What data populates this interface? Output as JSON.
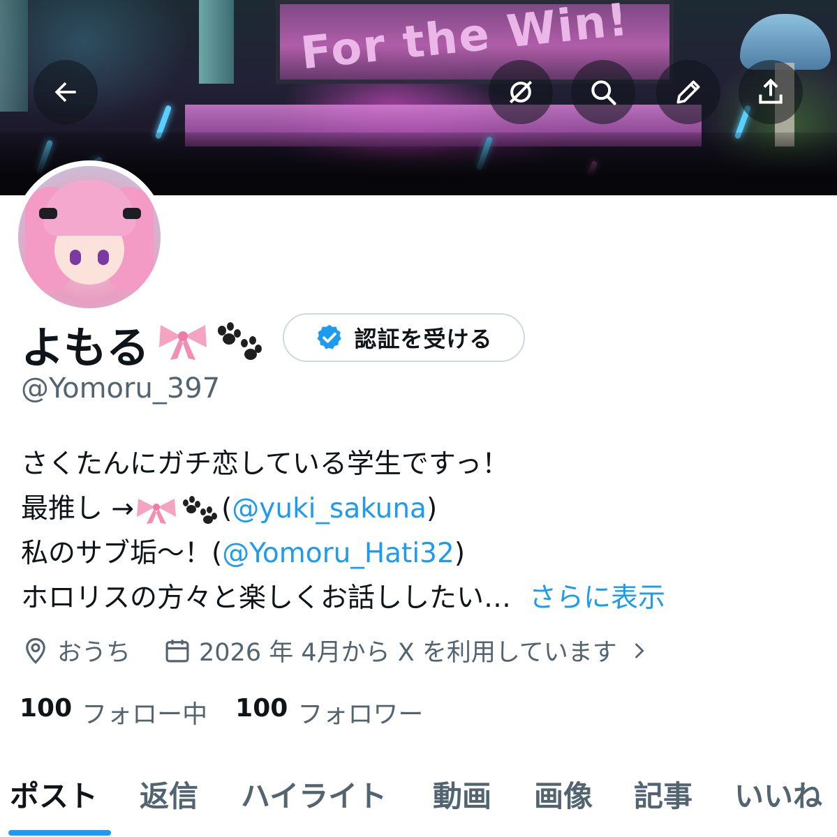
{
  "header": {
    "back_icon": "arrow-left-icon",
    "actions": [
      "grok-icon",
      "search-icon",
      "pencil-icon",
      "share-icon"
    ]
  },
  "banner": {
    "stage_text": "For the Win!"
  },
  "profile": {
    "display_name": "よもる",
    "name_emoji": "🎀🐾",
    "verify_button_label": "認証を受ける",
    "handle": "@Yomoru_397",
    "bio": {
      "line1": "さくたんにガチ恋している学生ですっ！",
      "line2_prefix": "最推し →",
      "line2_emoji": "🎀🐾",
      "line2_open": "(",
      "line2_mention": "@yuki_sakuna",
      "line2_close": ")",
      "line3_prefix": "私のサブ垢〜！(",
      "line3_mention": "@Yomoru_Hati32",
      "line3_close": ")",
      "line4": "ホロリスの方々と楽しくお話ししたい…",
      "show_more": "さらに表示"
    },
    "location": "おうち",
    "joined": "2026 年 4月から X を利用しています",
    "following_count": "100",
    "following_label": "フォロー中",
    "followers_count": "100",
    "followers_label": "フォロワー"
  },
  "tabs": [
    "ポスト",
    "返信",
    "ハイライト",
    "動画",
    "画像",
    "記事",
    "いいね"
  ],
  "colors": {
    "accent": "#1d9bf0",
    "secondary_text": "#536471",
    "primary_text": "#0f1419"
  }
}
